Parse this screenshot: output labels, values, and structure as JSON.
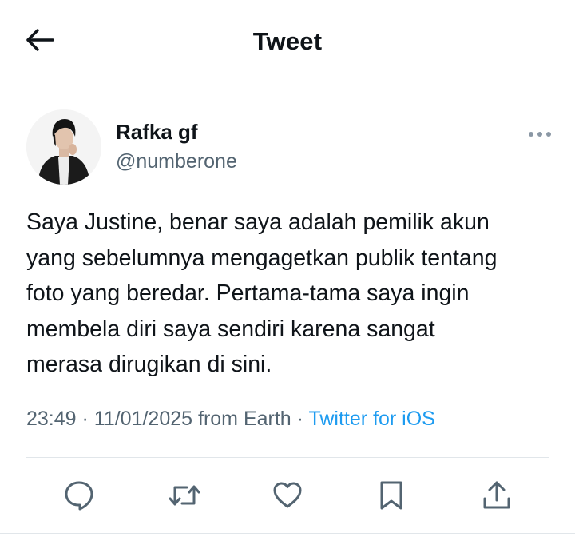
{
  "header": {
    "title": "Tweet",
    "back_icon": "arrow-left-icon"
  },
  "tweet": {
    "author": {
      "display_name": "Rafka gf",
      "handle": "@numberone"
    },
    "text": "Saya Justine, benar saya adalah pemilik akun\nyang sebelumnya mengagetkan publik tentang\nfoto yang beredar. Pertama-tama saya ingin\nmembela diri saya sendiri karena sangat\nmerasa dirugikan di sini.",
    "time": "23:49",
    "sep1": " · ",
    "date": "11/01/2025",
    "from": " from Earth",
    "sep2": " · ",
    "source": "Twitter for iOS"
  },
  "actions": {
    "icons": [
      "reply-icon",
      "retweet-icon",
      "like-icon",
      "bookmark-icon",
      "share-icon"
    ]
  },
  "colors": {
    "text": "#0f1419",
    "secondary": "#536471",
    "link": "#1d9bf0",
    "divider": "#e1e6ea"
  }
}
